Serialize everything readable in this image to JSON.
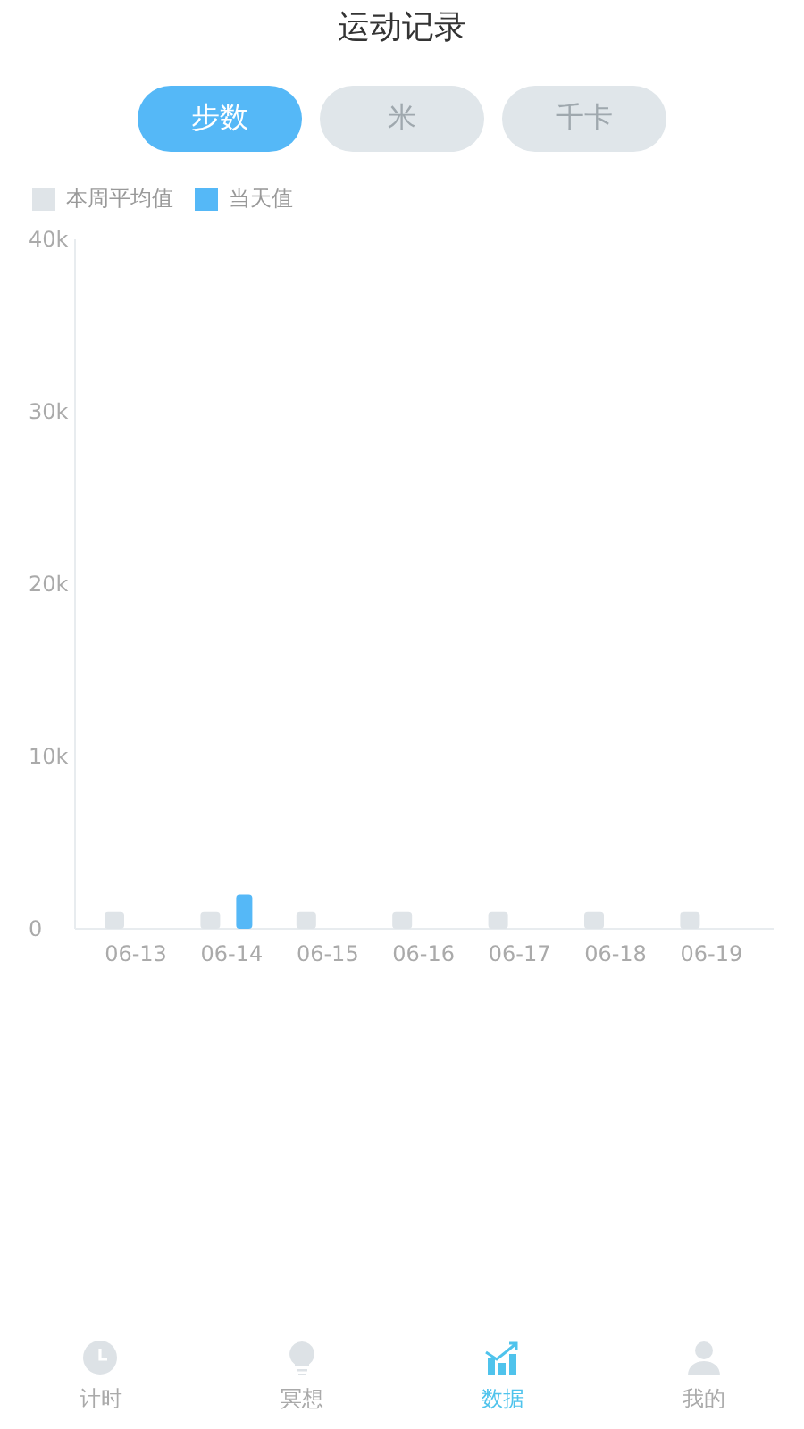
{
  "title": "运动记录",
  "tabs": [
    {
      "label": "步数",
      "selected": true
    },
    {
      "label": "米",
      "selected": false
    },
    {
      "label": "千卡",
      "selected": false
    }
  ],
  "chart": {
    "chart_data": {
      "type": "bar",
      "categories": [
        "06-13",
        "06-14",
        "06-15",
        "06-16",
        "06-17",
        "06-18",
        "06-19"
      ],
      "series": [
        {
          "name": "本周平均值",
          "color": "#dfe4e8",
          "values": [
            1000,
            1000,
            1000,
            1000,
            1000,
            1000,
            1000
          ]
        },
        {
          "name": "当天值",
          "color": "#55b8f7",
          "values": [
            null,
            2000,
            null,
            null,
            null,
            null,
            null
          ]
        }
      ],
      "ylim": [
        0,
        40000
      ],
      "yticks": [
        {
          "value": 0,
          "label": "0"
        },
        {
          "value": 10000,
          "label": "10k"
        },
        {
          "value": 20000,
          "label": "20k"
        },
        {
          "value": 30000,
          "label": "30k"
        },
        {
          "value": 40000,
          "label": "40k"
        }
      ]
    }
  },
  "nav": [
    {
      "label": "计时",
      "kind": "clock",
      "selected": false
    },
    {
      "label": "冥想",
      "kind": "bulb",
      "selected": false
    },
    {
      "label": "数据",
      "kind": "stats",
      "selected": true
    },
    {
      "label": "我的",
      "kind": "person",
      "selected": false
    }
  ]
}
